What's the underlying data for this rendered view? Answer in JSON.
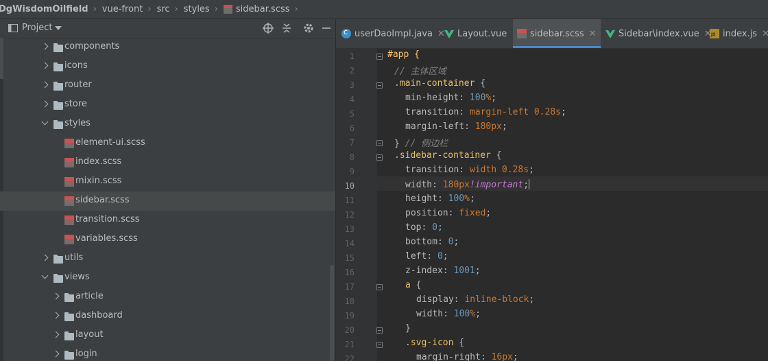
{
  "breadcrumb": [
    "DgWisdomOilfield",
    "vue-front",
    "src",
    "styles",
    "sidebar.scss"
  ],
  "project_panel": {
    "title": "Project",
    "icons": [
      "crosshair-icon",
      "collapse-icon",
      "gear-icon",
      "minimize-icon"
    ],
    "tree": [
      {
        "label": "components",
        "type": "folder",
        "expanded": false
      },
      {
        "label": "icons",
        "type": "folder",
        "expanded": false
      },
      {
        "label": "router",
        "type": "folder",
        "expanded": false
      },
      {
        "label": "store",
        "type": "folder",
        "expanded": false
      },
      {
        "label": "styles",
        "type": "folder",
        "expanded": true
      },
      {
        "label": "element-ui.scss",
        "type": "scss"
      },
      {
        "label": "index.scss",
        "type": "scss"
      },
      {
        "label": "mixin.scss",
        "type": "scss"
      },
      {
        "label": "sidebar.scss",
        "type": "scss",
        "selected": true
      },
      {
        "label": "transition.scss",
        "type": "scss"
      },
      {
        "label": "variables.scss",
        "type": "scss"
      },
      {
        "label": "utils",
        "type": "folder",
        "expanded": false
      },
      {
        "label": "views",
        "type": "folder",
        "expanded": true
      },
      {
        "label": "article",
        "type": "folder",
        "expanded": false
      },
      {
        "label": "dashboard",
        "type": "folder",
        "expanded": false
      },
      {
        "label": "layout",
        "type": "folder",
        "expanded": false
      },
      {
        "label": "login",
        "type": "folder",
        "expanded": false
      }
    ],
    "scss_badge": "SASS"
  },
  "tabs": [
    {
      "label": "userDaoImpl.java",
      "icon": "java-class-icon"
    },
    {
      "label": "Layout.vue",
      "icon": "vue-icon"
    },
    {
      "label": "sidebar.scss",
      "icon": "sass-icon",
      "active": true
    },
    {
      "label": "Sidebar\\index.vue",
      "icon": "vue-icon"
    },
    {
      "label": "index.js",
      "icon": "js-icon"
    }
  ],
  "editor": {
    "current_line": 10,
    "lines": [
      {
        "n": "1"
      },
      {
        "n": "2"
      },
      {
        "n": "3"
      },
      {
        "n": "4"
      },
      {
        "n": "5"
      },
      {
        "n": "6"
      },
      {
        "n": "7"
      },
      {
        "n": "8"
      },
      {
        "n": "9"
      },
      {
        "n": "10"
      },
      {
        "n": "11"
      },
      {
        "n": "12"
      },
      {
        "n": "13"
      },
      {
        "n": "14"
      },
      {
        "n": "15"
      },
      {
        "n": "16"
      },
      {
        "n": "17"
      },
      {
        "n": "18"
      },
      {
        "n": "19"
      },
      {
        "n": "20"
      },
      {
        "n": "21"
      },
      {
        "n": "22"
      }
    ],
    "code": {
      "l1": "#app {",
      "l2_comment": "// 主体区域",
      "l3_sel": ".main-container",
      "l4_prop": "min-height",
      "l4_val": "100",
      "l5_prop": "transition",
      "l5_val": "margin-left 0.28s",
      "l6_prop": "margin-left",
      "l6_val": "180px",
      "l7_comment": "// 侧边栏",
      "l8_sel": ".sidebar-container",
      "l9_prop": "transition",
      "l9_val": "width 0.28s",
      "l10_prop": "width",
      "l10_val": "180px",
      "l10_imp": "!important",
      "l11_prop": "height",
      "l11_val": "100",
      "l12_prop": "position",
      "l12_val": "fixed",
      "l13_prop": "top",
      "l13_val": "0",
      "l14_prop": "bottom",
      "l14_val": "0",
      "l15_prop": "left",
      "l15_val": "0",
      "l16_prop": "z-index",
      "l16_val": "1001",
      "l17_tag": "a",
      "l18_prop": "display",
      "l18_val": "inline-block",
      "l19_prop": "width",
      "l19_val": "100",
      "l21_sel": ".svg-icon",
      "l22_prop": "margin-right",
      "l22_val": "16px"
    }
  }
}
